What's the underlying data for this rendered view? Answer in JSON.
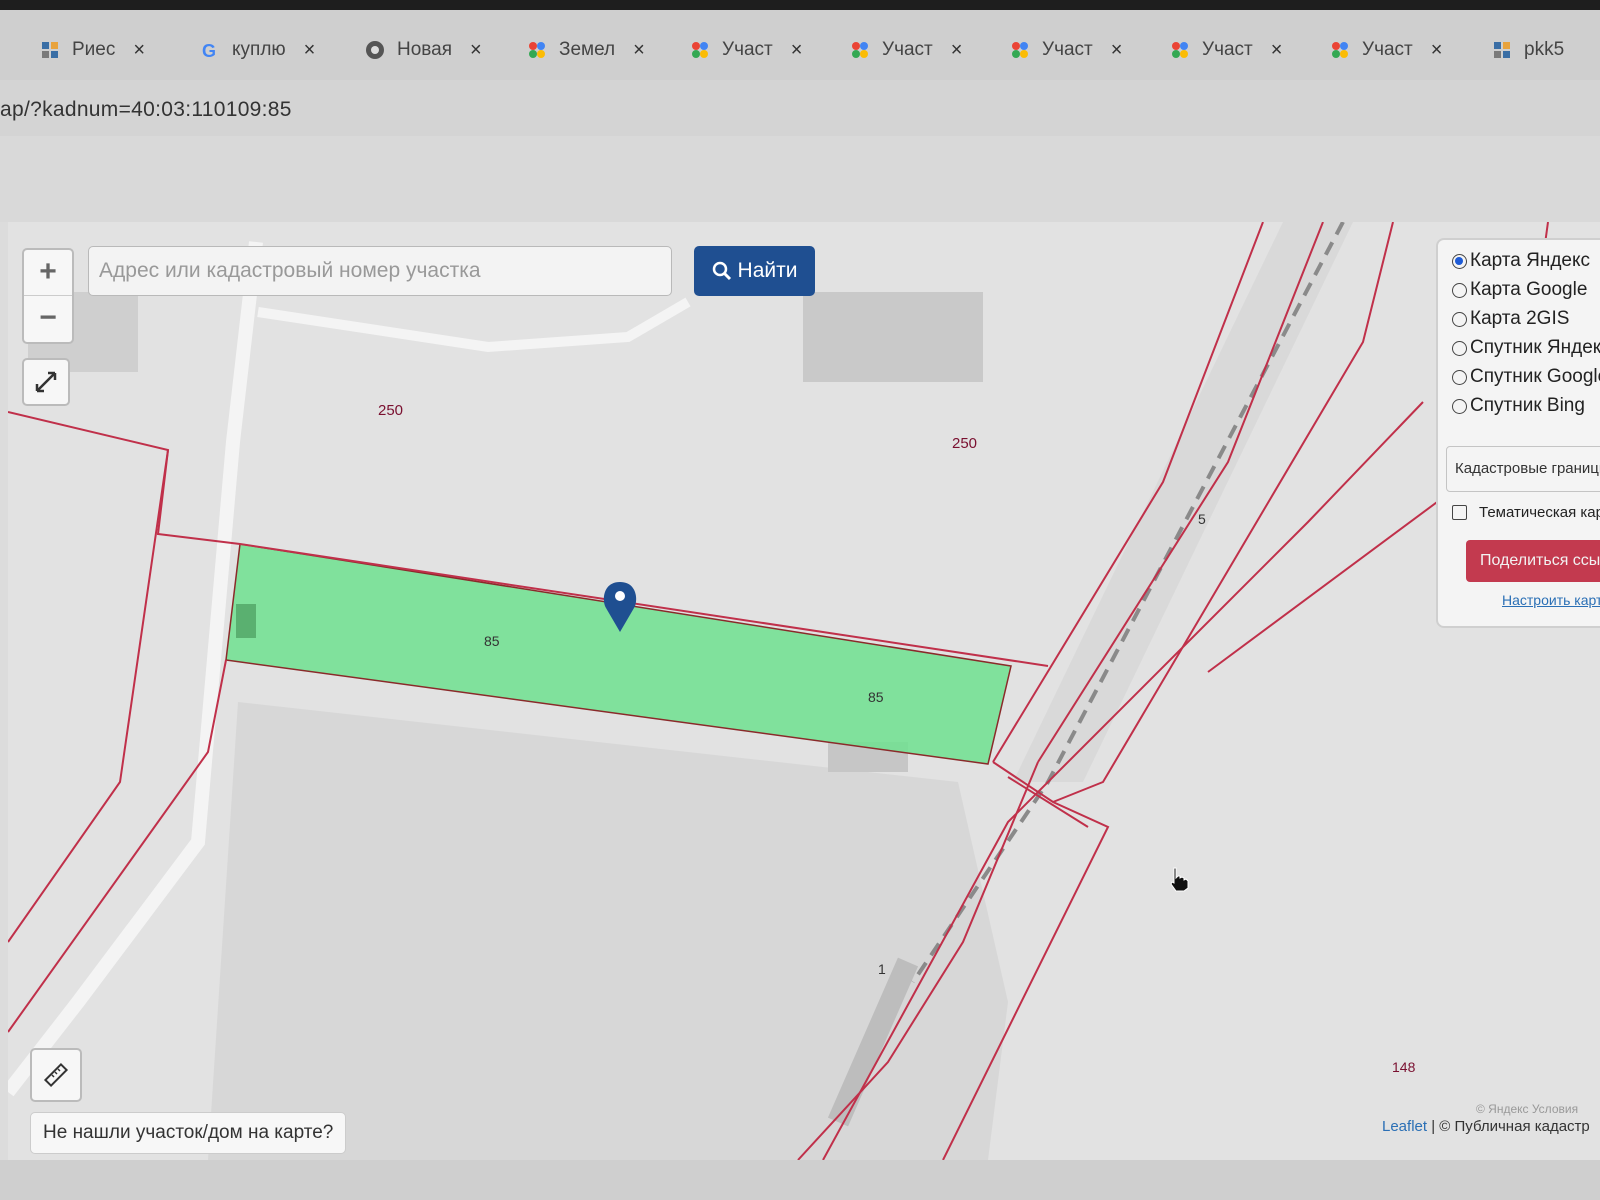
{
  "browser": {
    "tabs": [
      {
        "label": "Риес",
        "icon": "registry-icon"
      },
      {
        "label": "куплю",
        "icon": "google-icon"
      },
      {
        "label": "Новая",
        "icon": "chrome-icon"
      },
      {
        "label": "Земел",
        "icon": "colorful-dots-icon"
      },
      {
        "label": "Участ",
        "icon": "colorful-dots-icon"
      },
      {
        "label": "Участ",
        "icon": "colorful-dots-icon"
      },
      {
        "label": "Участ",
        "icon": "colorful-dots-icon"
      },
      {
        "label": "Участ",
        "icon": "colorful-dots-icon"
      },
      {
        "label": "Участ",
        "icon": "colorful-dots-icon"
      },
      {
        "label": "pkk5",
        "icon": "pkk-icon"
      }
    ],
    "close_glyph": "×",
    "url": "ap/?kadnum=40:03:110109:85"
  },
  "map": {
    "search": {
      "placeholder": "Адрес или кадастровый номер участка",
      "button_label": "Найти"
    },
    "zoom_in": "+",
    "zoom_out": "−",
    "labels": {
      "parcel_250_left": "250",
      "parcel_250_right": "250",
      "parcel_85_a": "85",
      "parcel_85_b": "85",
      "parcel_5": "5",
      "parcel_1": "1",
      "parcel_148": "148"
    },
    "not_found_button": "Не нашли участок/дом на карте?",
    "attribution_link": "Leaflet",
    "attribution_text": " | © Публичная кадастр",
    "attribution_faint": "© Яндекс Условия"
  },
  "layers_panel": {
    "options": [
      {
        "label": "Карта Яндекс",
        "selected": true
      },
      {
        "label": "Карта Google",
        "selected": false
      },
      {
        "label": "Карта 2GIS",
        "selected": false
      },
      {
        "label": "Спутник Яндекс",
        "selected": false
      },
      {
        "label": "Спутник Google",
        "selected": false
      },
      {
        "label": "Спутник Bing",
        "selected": false
      }
    ],
    "overlay_select": "Кадастровые границы",
    "thematic_label": "Тематическая карта",
    "share_button": "Поделиться ссылкой",
    "configure_link": "Настроить карту"
  },
  "colors": {
    "accent_blue": "#1f4f91",
    "parcel_green": "#6ee08f",
    "boundary_red": "#c0304a",
    "share_red": "#c33a4f"
  }
}
